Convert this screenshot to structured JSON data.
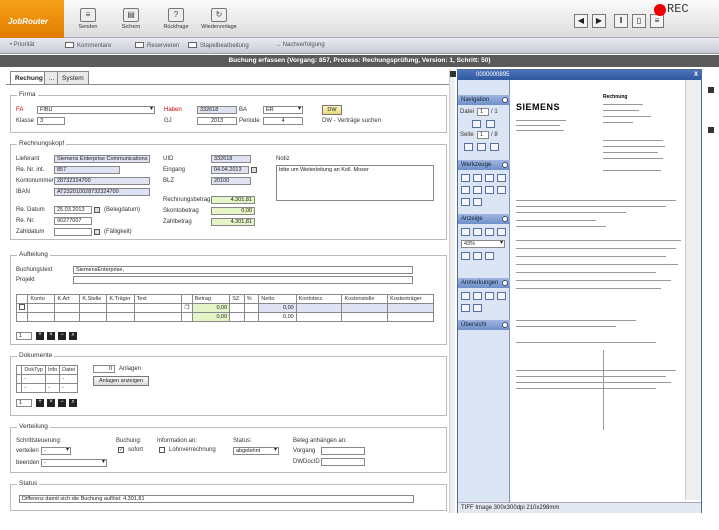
{
  "toolbar": {
    "logo": "JobRouter",
    "buttons": [
      {
        "icon": "send-icon",
        "label": "Senden"
      },
      {
        "icon": "save-icon",
        "label": "Sichern"
      },
      {
        "icon": "question-icon",
        "label": "Rückfrage"
      },
      {
        "icon": "resubmit-icon",
        "label": "Wiedervorlage"
      }
    ],
    "right_icons": [
      "arrow-left-icon",
      "arrow-right-icon",
      "pause-icon",
      "document-icon",
      "list-icon",
      "flag-icon"
    ],
    "rec_label": "REC"
  },
  "subbar": [
    "Priorität",
    "Kommentare",
    "Reservieren",
    "Stapelbearbeitung",
    "Nachverfolgung"
  ],
  "title": "Buchung erfassen (Vorgang: 857, Prozess: Rechungsprüfung, Version: 1, Schritt: 50)",
  "tabs": [
    "Rechung",
    "...",
    "System"
  ],
  "firma": {
    "title": "Firma",
    "fa_label": "FA",
    "fa_value": "FIBU",
    "klasse_label": "Klasse",
    "klasse_value": "3",
    "haben_label": "Haben",
    "haben_value": "332618",
    "gj_label": "GJ",
    "gj_value": "2013",
    "ba_label": "BA",
    "ba_value": "ER",
    "periode_label": "Periode",
    "periode_value": "4",
    "dw_button": "DW",
    "dw_text": "DW - Verträge suchen"
  },
  "rechnungskopf": {
    "title": "Rechnungskopf",
    "lieferant_label": "Lieferant",
    "lieferant_value": "Siemens Enterprise Communications G",
    "renr_int_label": "Re. Nr. int.",
    "renr_int_value": "857",
    "kontonummer_label": "Kontonummer",
    "kontonummer_value": "28732324700",
    "iban_label": "IBAN",
    "iban_value": "AT232010028732324700",
    "redatum_label": "Re. Datum",
    "redatum_value": "25.03.2013",
    "belegdatum": "(Belegdatum)",
    "renr_label": "Re. Nr.",
    "renr_value": "90277007",
    "zahldatum_label": "Zahldatum",
    "zahldatum_value": "",
    "faelligkeit": "(Fälligkeit)",
    "uid_label": "UID",
    "uid_value": "332618",
    "eingang_label": "Eingang",
    "eingang_value": "04.04.2013",
    "blz_label": "BLZ",
    "blz_value": "20100",
    "rechnungsbetrag_label": "Rechnungsbetrag",
    "rechnungsbetrag_value": "4.301,81",
    "skontobetrag_label": "Skontobetrag",
    "skontobetrag_value": "0,00",
    "zahlbetrag_label": "Zahlbetrag",
    "zahlbetrag_value": "4.301,81",
    "notiz_label": "Notiz",
    "notiz_value": "bitte um Weiterleitung an Koll. Moser"
  },
  "aufteilung": {
    "title": "Aufteilung",
    "buchungstext_label": "Buchungstext",
    "buchungstext_value": "SiemensEnterprise,",
    "projekt_label": "Projekt",
    "projekt_value": "",
    "columns": [
      "",
      "Konto",
      "K.Art",
      "K.Stelle",
      "K.Träger",
      "Text",
      "",
      "Betrag",
      "SZ",
      "%",
      "Netto",
      "Kontobez.",
      "Kostenstelle",
      "Kostenträger"
    ],
    "rows": [
      {
        "betrag": "0,00",
        "netto": "0,00"
      },
      {
        "betrag": "0,00",
        "netto": "0,00"
      }
    ],
    "counter": "1"
  },
  "dokumente": {
    "title": "Dokumente",
    "columns": [
      "",
      "DokTyp",
      "Info",
      "Datei"
    ],
    "rows": [
      [
        "",
        "-",
        "",
        "-"
      ],
      [
        "",
        "-",
        "-",
        "-"
      ]
    ],
    "anlagen_value": "0",
    "anlagen_label": "Anlagen",
    "anlagen_button": "Anlagen anzeigen",
    "counter": "1"
  },
  "verteilung": {
    "title": "Verteilung",
    "schrittsteuerung_label": "Schrittsteuerung:",
    "verteilen_label": "verteilen",
    "verteilen_value": "-",
    "beenden_label": "beenden",
    "beenden_value": "-",
    "buchung_label": "Buchung:",
    "sofort_label": "sofort",
    "information_label": "Information an:",
    "lohnverrechnung_label": "Lohnverrechnung",
    "status_label": "Status:",
    "status_value": "abgelehnt",
    "beleg_label": "Beleg anhängen an:",
    "vorgang_label": "Vorgang",
    "dwdocid_label": "DWDocID"
  },
  "status": {
    "title": "Status",
    "value": "Differenz damit sich die Buchung auflöst: 4.301,81"
  },
  "viewer": {
    "title": "0000000895",
    "nav_label": "Navigation",
    "datei_label": "Datei",
    "datei_value": "1",
    "datei_total": "/ 1",
    "seite_label": "Seite",
    "seite_value": "1",
    "seite_total": "/ 8",
    "werkzeuge_label": "Werkzeuge",
    "anzeige_label": "Anzeige",
    "zoom_value": "43%",
    "anmerkungen_label": "Anmerkungen",
    "uebersicht_label": "Übersicht",
    "status": "TIFF Image 300x300dpi 210x298mm",
    "doc_brand": "SIEMENS",
    "doc_heading": "Rechnung"
  },
  "colors": {
    "accent_orange": "#f7a21a",
    "title_bar": "#5a5a5a",
    "viewer_blue": "#2e58a0",
    "field_blue": "#dfe2f2",
    "field_green": "#e6f5c8",
    "label_red": "#cc0000"
  }
}
